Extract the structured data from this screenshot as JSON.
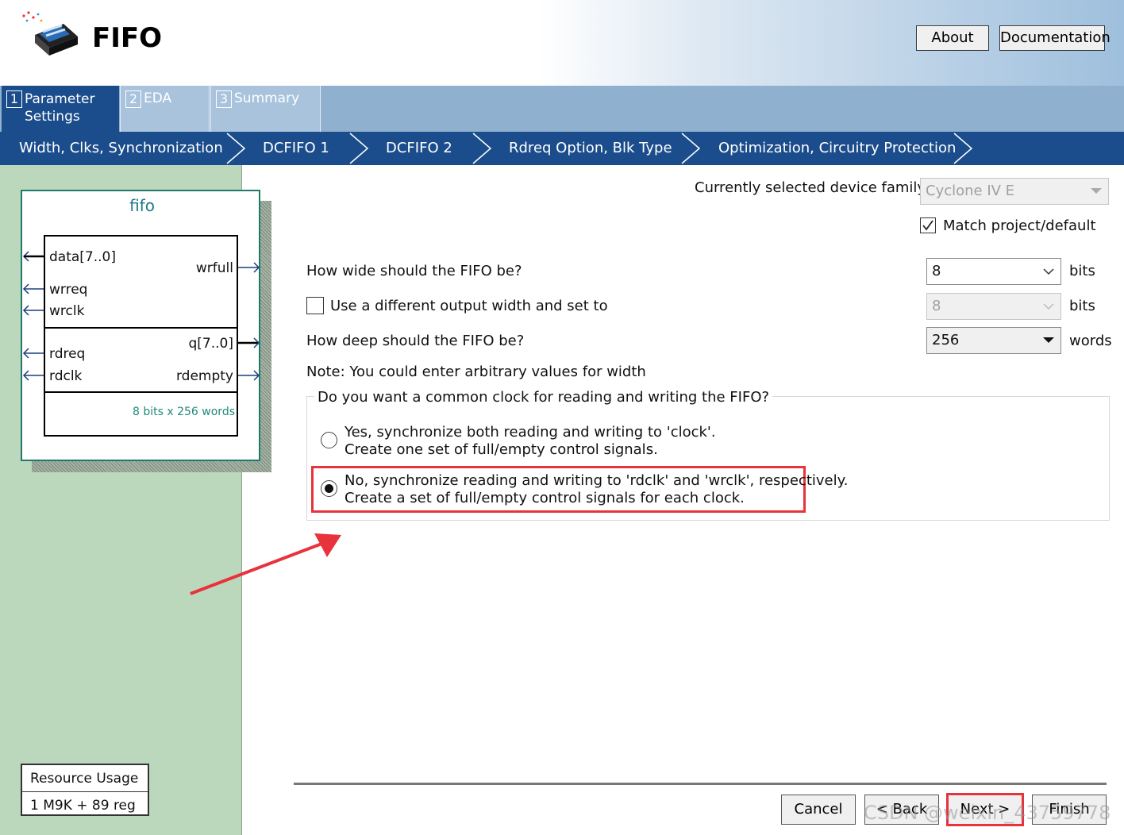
{
  "app": {
    "title": "FIFO"
  },
  "header_buttons": {
    "about": "About",
    "documentation": "Documentation"
  },
  "tabs": [
    {
      "num": "1",
      "line1": "Parameter",
      "line2": "Settings"
    },
    {
      "num": "2",
      "line1": "EDA",
      "line2": ""
    },
    {
      "num": "3",
      "line1": "Summary",
      "line2": ""
    }
  ],
  "breadcrumb": [
    "Width, Clks, Synchronization",
    "DCFIFO 1",
    "DCFIFO 2",
    "Rdreq Option, Blk Type",
    "Optimization, Circuitry Protection"
  ],
  "symbol": {
    "title": "fifo",
    "pins": {
      "data": "data[7..0]",
      "wrfull": "wrfull",
      "wrreq": "wrreq",
      "wrclk": "wrclk",
      "q": "q[7..0]",
      "rdreq": "rdreq",
      "rdclk": "rdclk",
      "rdempty": "rdempty"
    },
    "size_note": "8 bits x 256 words"
  },
  "resource": {
    "header": "Resource Usage",
    "value": "1 M9K + 89 reg"
  },
  "device": {
    "label": "Currently selected device family:",
    "value": "Cyclone IV E",
    "match_label": "Match project/default",
    "match_checked": true
  },
  "width": {
    "question": "How wide should the FIFO be?",
    "value": "8",
    "unit": "bits"
  },
  "output_width": {
    "label": "Use a different output width and set to",
    "value": "8",
    "unit": "bits",
    "checked": false
  },
  "depth": {
    "question": "How deep should the FIFO be?",
    "value": "256",
    "unit": "words"
  },
  "note": "Note: You could enter arbitrary values for width",
  "clock_group": {
    "title": "Do you want a common clock for reading and writing the FIFO?",
    "option_yes": {
      "line1": "Yes, synchronize both reading and writing to 'clock'.",
      "line2": "Create one set of full/empty control signals.",
      "selected": false
    },
    "option_no": {
      "line1": "No, synchronize reading and writing to 'rdclk' and 'wrclk', respectively.",
      "line2": "Create a set of full/empty control signals for each clock.",
      "selected": true
    }
  },
  "footer_buttons": {
    "cancel": "Cancel",
    "back": "< Back",
    "next": "Next >",
    "finish": "Finish"
  },
  "watermark": "CSDN @weixin_43759778",
  "colors": {
    "accent_blue": "#1b4d8c",
    "highlight_red": "#e8323c",
    "panel_green": "#bcd8bc"
  }
}
